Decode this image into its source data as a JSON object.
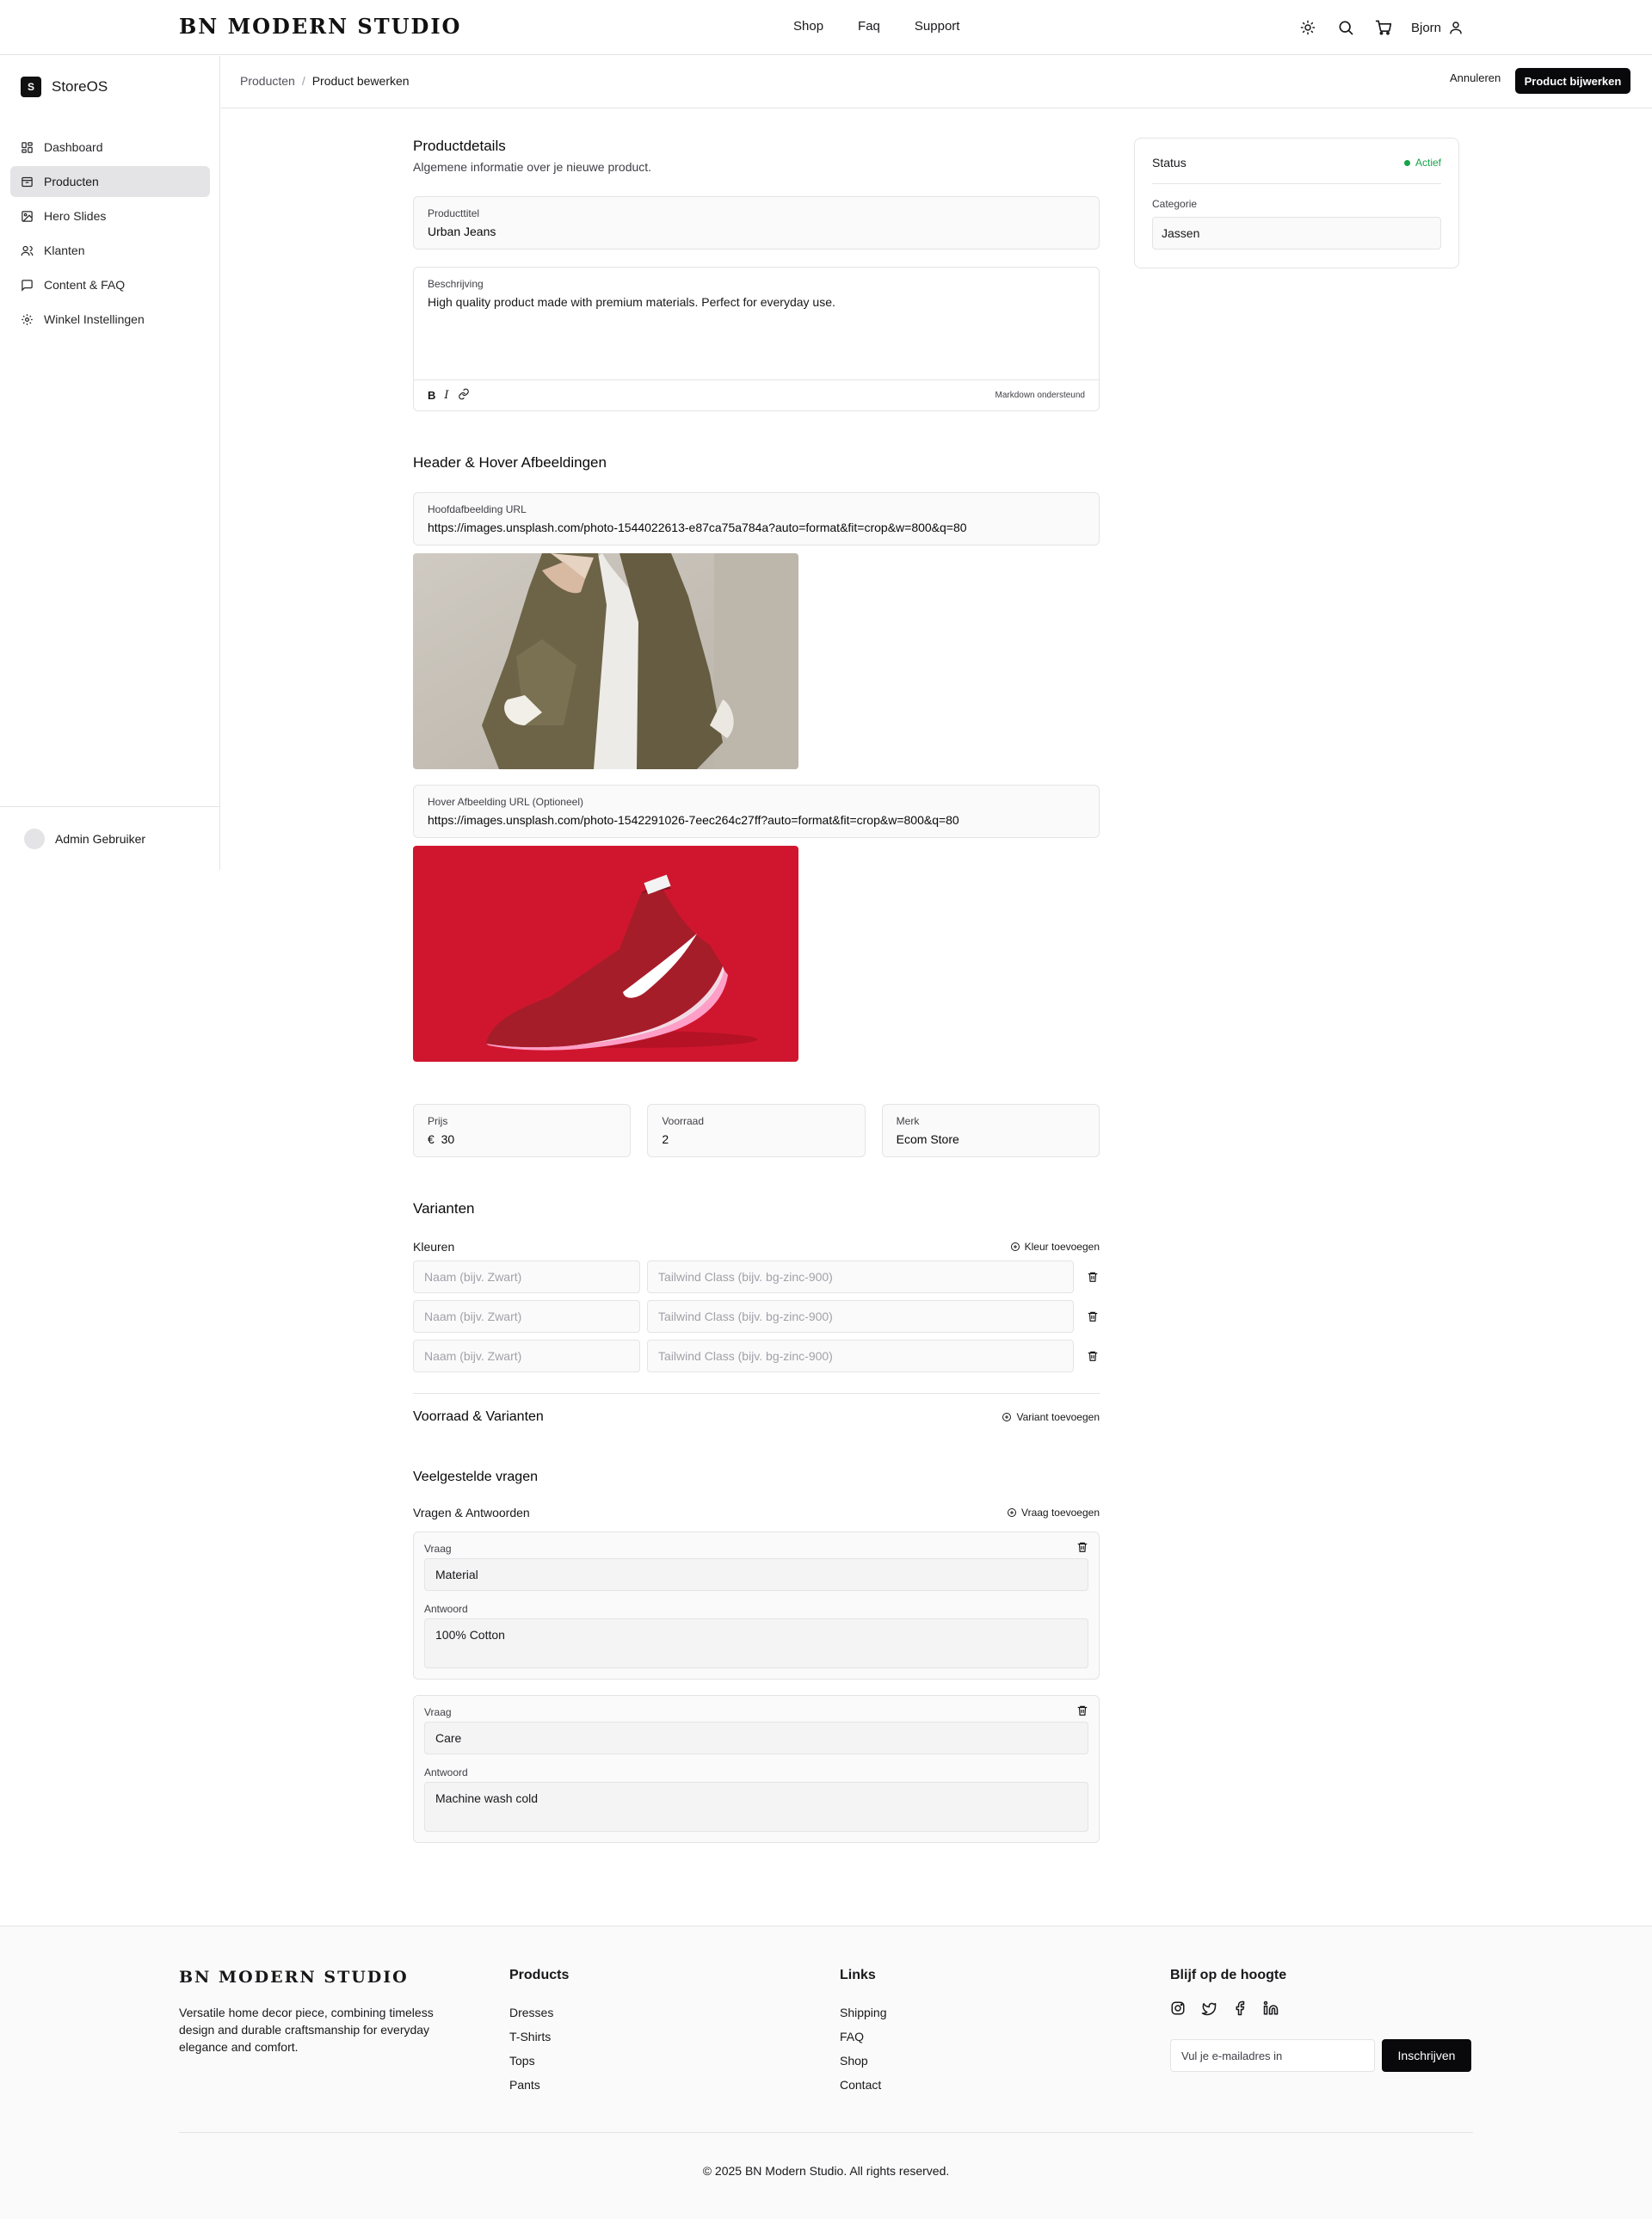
{
  "nav": {
    "brand": "BN MODERN STUDIO",
    "links": [
      "Shop",
      "Faq",
      "Support"
    ],
    "user": "Bjorn"
  },
  "sidebar": {
    "app_name": "StoreOS",
    "logo_letter": "S",
    "items": [
      {
        "label": "Dashboard",
        "icon": "grid-icon"
      },
      {
        "label": "Producten",
        "icon": "box-icon",
        "active": true
      },
      {
        "label": "Hero Slides",
        "icon": "image-icon"
      },
      {
        "label": "Klanten",
        "icon": "users-icon"
      },
      {
        "label": "Content & FAQ",
        "icon": "message-icon"
      },
      {
        "label": "Winkel Instellingen",
        "icon": "settings-icon"
      }
    ],
    "account": "Admin Gebruiker"
  },
  "header": {
    "breadcrumb": [
      "Producten",
      "Product bewerken"
    ],
    "cancel_label": "Annuleren",
    "submit_label": "Product bijwerken"
  },
  "details": {
    "title": "Productdetails",
    "subtitle": "Algemene informatie over je nieuwe product.",
    "product_title_label": "Producttitel",
    "product_title_value": "Urban Jeans",
    "description_label": "Beschrijving",
    "description_value": "High quality product made with premium materials. Perfect for everyday use.",
    "markdown_note": "Markdown ondersteund"
  },
  "images": {
    "title": "Header & Hover Afbeeldingen",
    "main_label": "Hoofdafbeelding URL",
    "main_url": "https://images.unsplash.com/photo-1544022613-e87ca75a784a?auto=format&fit=crop&w=800&q=80",
    "hover_label": "Hover Afbeelding URL (Optioneel)",
    "hover_url": "https://images.unsplash.com/photo-1542291026-7eec264c27ff?auto=format&fit=crop&w=800&q=80"
  },
  "pricing": {
    "price_label": "Prijs",
    "currency": "€",
    "price_value": "30",
    "stock_label": "Voorraad",
    "stock_value": "2",
    "brand_label": "Merk",
    "brand_value": "Ecom Store"
  },
  "variants": {
    "title": "Varianten",
    "colors_label": "Kleuren",
    "add_color": "Kleur toevoegen",
    "name_placeholder": "Naam (bijv. Zwart)",
    "class_placeholder": "Tailwind Class (bijv. bg-zinc-900)",
    "stock_variants_title": "Voorraad & Varianten",
    "add_variant": "Variant toevoegen"
  },
  "faq": {
    "title": "Veelgestelde vragen",
    "qa_label": "Vragen & Antwoorden",
    "add_question": "Vraag toevoegen",
    "question_label": "Vraag",
    "answer_label": "Antwoord",
    "items": [
      {
        "question": "Material",
        "answer": "100% Cotton"
      },
      {
        "question": "Care",
        "answer": "Machine wash cold"
      }
    ]
  },
  "status": {
    "title": "Status",
    "value": "Actief",
    "category_label": "Categorie",
    "category_value": "Jassen"
  },
  "footer": {
    "brand": "BN MODERN STUDIO",
    "description": "Versatile home decor piece, combining timeless design and durable craftsmanship for everyday elegance and comfort.",
    "products_title": "Products",
    "products": [
      "Dresses",
      "T-Shirts",
      "Tops",
      "Pants"
    ],
    "links_title": "Links",
    "links": [
      "Shipping",
      "FAQ",
      "Shop",
      "Contact"
    ],
    "newsletter_title": "Blijf op de hoogte",
    "email_placeholder": "Vul je e-mailadres in",
    "subscribe_label": "Inschrijven",
    "copyright": "© 2025 BN Modern Studio. All rights reserved."
  },
  "colors": {
    "accent": "#09090b",
    "status_green": "#16a34a",
    "border": "#e4e4e7"
  }
}
